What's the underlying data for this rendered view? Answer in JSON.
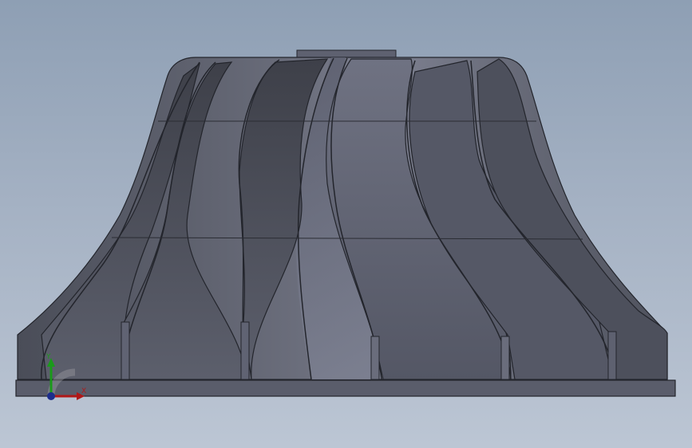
{
  "viewport": {
    "background_top": "#8e9fb4",
    "background_bottom": "#bcc6d4"
  },
  "model": {
    "body_color": "#5b5f6d",
    "edge_color": "#23252c",
    "highlight_color": "#7a7e8e"
  },
  "triad": {
    "x_label": "X",
    "y_label": "Y",
    "x_color": "#b01818",
    "y_color": "#1a9a1a",
    "z_color": "#1c2d8c",
    "icon": "coordinate-triad-icon"
  }
}
